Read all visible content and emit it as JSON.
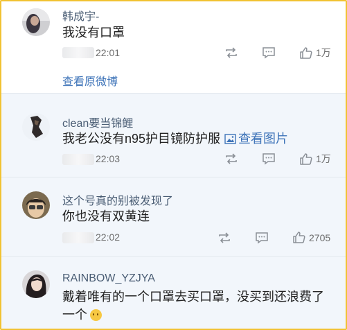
{
  "colors": {
    "frame": "#f1c232",
    "link": "#3d73b8",
    "username": "#4a5d74",
    "reply_bg": "#f2f6fb"
  },
  "comments": [
    {
      "username": "韩成宇-",
      "text": "我没有口罩",
      "time": "22:01",
      "likes": "1万",
      "view_original": "查看原微博",
      "avatar_icon": "user-avatar"
    },
    {
      "username": "clean要当锦鲤",
      "text": "我老公没有n95护目镜防护服",
      "view_image": "查看图片",
      "time": "22:03",
      "likes": "1万",
      "avatar_icon": "user-avatar"
    },
    {
      "username": "这个号真的别被发现了",
      "text": "你也没有双黄连",
      "time": "22:02",
      "likes": "2705",
      "avatar_icon": "user-avatar"
    },
    {
      "username": "RAINBOW_YZJYA",
      "text": "戴着唯有的一个口罩去买口罩，没买到还浪费了一个",
      "emoji_icon": "thinking-emoji-icon",
      "avatar_icon": "user-avatar"
    }
  ],
  "icons": {
    "repost": "repost-icon",
    "comment": "comment-icon",
    "like": "thumbs-up-icon",
    "image": "image-icon"
  }
}
